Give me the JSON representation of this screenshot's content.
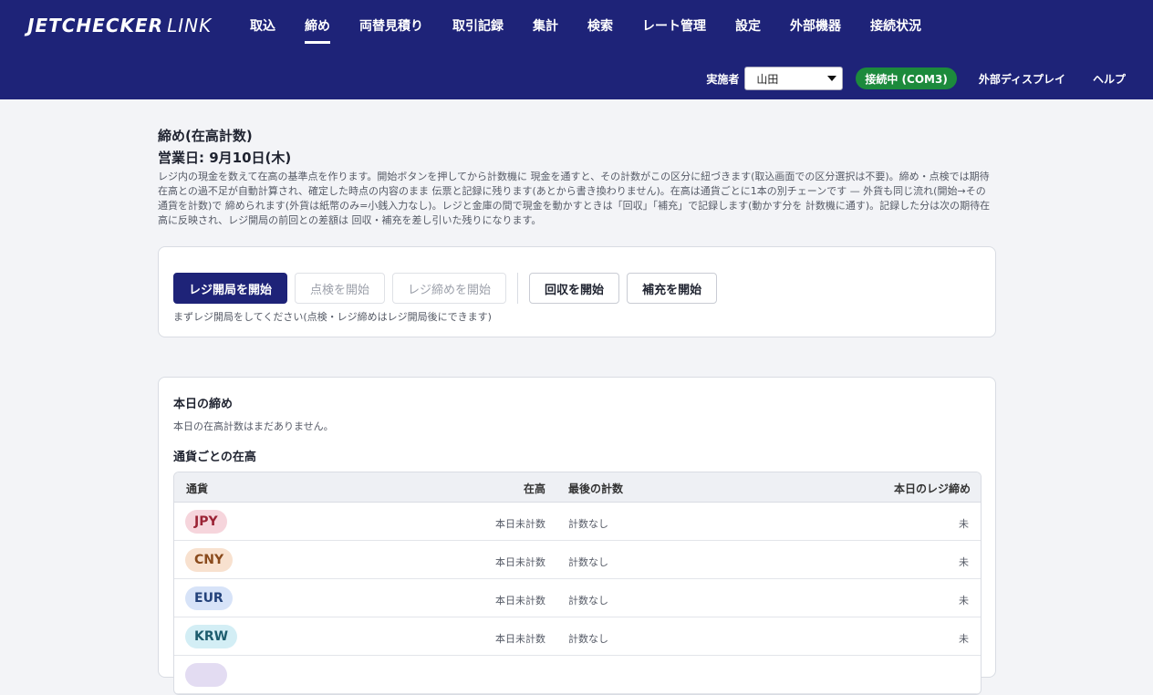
{
  "header": {
    "logo_bold": "JETCHECKER",
    "logo_light": "LINK",
    "nav": [
      "取込",
      "締め",
      "両替見積り",
      "取引記録",
      "集計",
      "検索",
      "レート管理",
      "設定",
      "外部機器",
      "接続状況"
    ],
    "nav_active": "締め",
    "implementer_label": "実施者",
    "implementer_value": "山田",
    "connection_status": "接続中 (COM3)",
    "external_display": "外部ディスプレイ",
    "help": "ヘルプ"
  },
  "page": {
    "title": "締め(在高計数)",
    "business_date": "営業日: 9月10日(木)",
    "description": "レジ内の現金を数えて在高の基準点を作ります。開始ボタンを押してから計数機に 現金を通すと、その計数がこの区分に紐づきます(取込画面での区分選択は不要)。締め・点検では期待在高との過不足が自動計算され、確定した時点の内容のまま 伝票と記録に残ります(あとから書き換わりません)。在高は通貨ごとに1本の別チェーンです — 外貨も同じ流れ(開始→その通貨を計数)で 締められます(外貨は紙幣のみ=小銭入力なし)。レジと金庫の間で現金を動かすときは「回収」「補充」で記録します(動かす分を 計数機に通す)。記録した分は次の期待在高に反映され、レジ開局の前回との差額は 回収・補充を差し引いた残りになります。"
  },
  "actions": {
    "open_register": "レジ開局を開始",
    "inspect": "点検を開始",
    "close_register": "レジ締めを開始",
    "collect": "回収を開始",
    "replenish": "補充を開始",
    "hint": "まずレジ開局をしてください(点検・レジ締めはレジ開局後にできます)"
  },
  "summary": {
    "today_title": "本日の締め",
    "today_note": "本日の在高計数はまだありません。",
    "by_currency_title": "通貨ごとの在高",
    "columns": {
      "currency": "通貨",
      "balance": "在高",
      "last_count": "最後の計数",
      "today_close": "本日のレジ締め"
    },
    "rows": [
      {
        "code": "JPY",
        "balance": "本日未計数",
        "last_count": "計数なし",
        "today_close": "未",
        "bg": "#f6d5dc",
        "fg": "#9b2335"
      },
      {
        "code": "CNY",
        "balance": "本日未計数",
        "last_count": "計数なし",
        "today_close": "未",
        "bg": "#f8e1cf",
        "fg": "#8a4a1c"
      },
      {
        "code": "EUR",
        "balance": "本日未計数",
        "last_count": "計数なし",
        "today_close": "未",
        "bg": "#d7e3f8",
        "fg": "#23427a"
      },
      {
        "code": "KRW",
        "balance": "本日未計数",
        "last_count": "計数なし",
        "today_close": "未",
        "bg": "#d3eef5",
        "fg": "#1d5d6e"
      }
    ]
  },
  "colors": {
    "header_bg": "#1e2378",
    "primary": "#1e2378",
    "connected": "#1c8a3c"
  }
}
